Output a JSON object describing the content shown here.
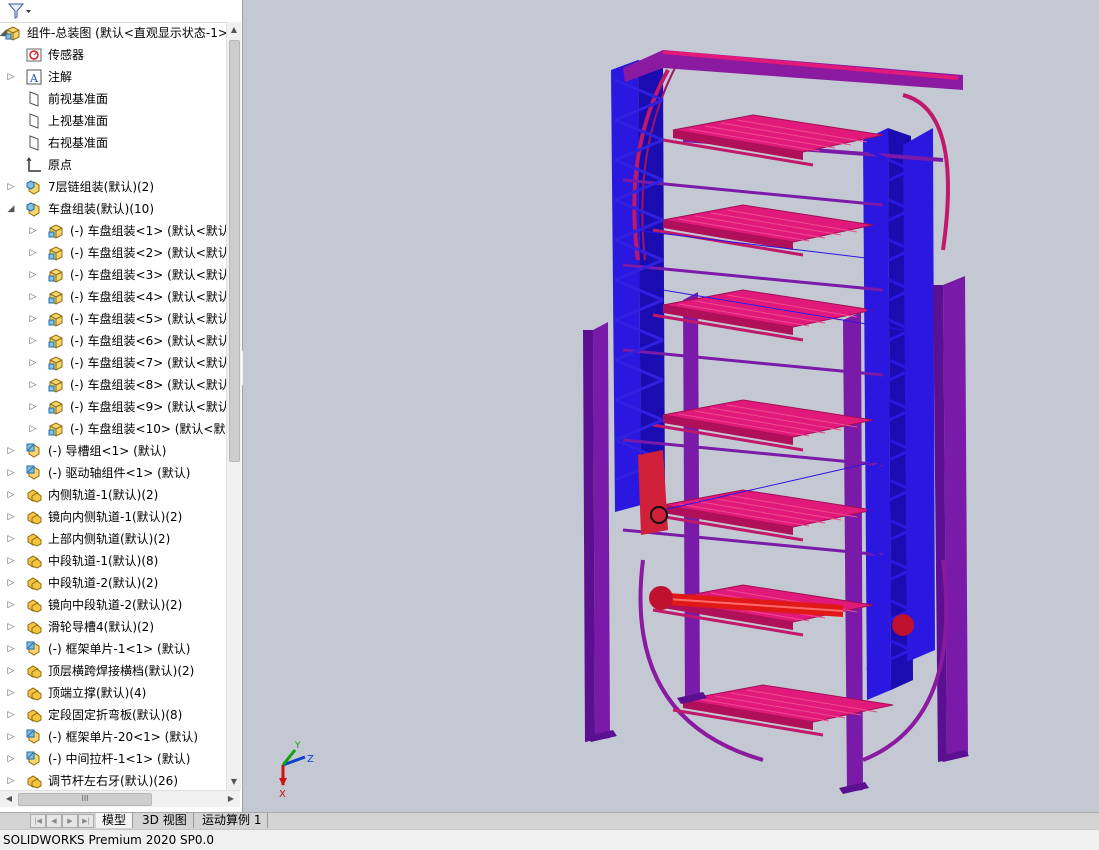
{
  "app": {
    "status_text": "SOLIDWORKS Premium 2020 SP0.0"
  },
  "tree": [
    {
      "label": "组件-总装图 (默认<直观显示状态-1>",
      "icon": "assembly-icon",
      "level": 0,
      "expander": "down"
    },
    {
      "label": "传感器",
      "icon": "sensor-icon",
      "level": 1,
      "expander": ""
    },
    {
      "label": "注解",
      "icon": "annotation-icon",
      "level": 1,
      "expander": "right"
    },
    {
      "label": "前视基准面",
      "icon": "plane-icon",
      "level": 1,
      "expander": ""
    },
    {
      "label": "上视基准面",
      "icon": "plane-icon",
      "level": 1,
      "expander": ""
    },
    {
      "label": "右视基准面",
      "icon": "plane-icon",
      "level": 1,
      "expander": ""
    },
    {
      "label": "原点",
      "icon": "origin-icon",
      "level": 1,
      "expander": ""
    },
    {
      "label": "7层链组装(默认)(2)",
      "icon": "subassembly-folder-icon",
      "level": 1,
      "expander": "right"
    },
    {
      "label": "车盘组装(默认)(10)",
      "icon": "subassembly-folder-icon",
      "level": 1,
      "expander": "down"
    },
    {
      "label": "(-) 车盘组装<1> (默认<默认",
      "icon": "assembly-icon",
      "level": 2,
      "expander": "right"
    },
    {
      "label": "(-) 车盘组装<2> (默认<默认",
      "icon": "assembly-icon",
      "level": 2,
      "expander": "right"
    },
    {
      "label": "(-) 车盘组装<3> (默认<默认",
      "icon": "assembly-icon",
      "level": 2,
      "expander": "right"
    },
    {
      "label": "(-) 车盘组装<4> (默认<默认",
      "icon": "assembly-icon",
      "level": 2,
      "expander": "right"
    },
    {
      "label": "(-) 车盘组装<5> (默认<默认",
      "icon": "assembly-icon",
      "level": 2,
      "expander": "right"
    },
    {
      "label": "(-) 车盘组装<6> (默认<默认",
      "icon": "assembly-icon",
      "level": 2,
      "expander": "right"
    },
    {
      "label": "(-) 车盘组装<7> (默认<默认",
      "icon": "assembly-icon",
      "level": 2,
      "expander": "right"
    },
    {
      "label": "(-) 车盘组装<8> (默认<默认",
      "icon": "assembly-icon",
      "level": 2,
      "expander": "right"
    },
    {
      "label": "(-) 车盘组装<9> (默认<默认",
      "icon": "assembly-icon",
      "level": 2,
      "expander": "right"
    },
    {
      "label": "(-) 车盘组装<10> (默认<默",
      "icon": "assembly-icon",
      "level": 2,
      "expander": "right"
    },
    {
      "label": "(-) 导槽组<1> (默认)",
      "icon": "part-icon",
      "level": 1,
      "expander": "right"
    },
    {
      "label": "(-) 驱动轴组件<1> (默认)",
      "icon": "part-icon",
      "level": 1,
      "expander": "right"
    },
    {
      "label": "内侧轨道-1(默认)(2)",
      "icon": "part-folder-icon",
      "level": 1,
      "expander": "right"
    },
    {
      "label": "镜向内侧轨道-1(默认)(2)",
      "icon": "part-folder-icon",
      "level": 1,
      "expander": "right"
    },
    {
      "label": "上部内侧轨道(默认)(2)",
      "icon": "part-folder-icon",
      "level": 1,
      "expander": "right"
    },
    {
      "label": "中段轨道-1(默认)(8)",
      "icon": "part-folder-icon",
      "level": 1,
      "expander": "right"
    },
    {
      "label": "中段轨道-2(默认)(2)",
      "icon": "part-folder-icon",
      "level": 1,
      "expander": "right"
    },
    {
      "label": "镜向中段轨道-2(默认)(2)",
      "icon": "part-folder-icon",
      "level": 1,
      "expander": "right"
    },
    {
      "label": "滑轮导槽4(默认)(2)",
      "icon": "part-folder-icon",
      "level": 1,
      "expander": "right"
    },
    {
      "label": "(-) 框架单片-1<1> (默认)",
      "icon": "part-icon",
      "level": 1,
      "expander": "right"
    },
    {
      "label": "顶层横跨焊接横档(默认)(2)",
      "icon": "part-folder-icon",
      "level": 1,
      "expander": "right"
    },
    {
      "label": "顶端立撑(默认)(4)",
      "icon": "part-folder-icon",
      "level": 1,
      "expander": "right"
    },
    {
      "label": "定段固定折弯板(默认)(8)",
      "icon": "part-folder-icon",
      "level": 1,
      "expander": "right"
    },
    {
      "label": "(-) 框架单片-20<1> (默认)",
      "icon": "part-icon",
      "level": 1,
      "expander": "right"
    },
    {
      "label": "(-) 中间拉杆-1<1> (默认)",
      "icon": "part-icon",
      "level": 1,
      "expander": "right"
    },
    {
      "label": "调节杆左右牙(默认)(26)",
      "icon": "part-folder-icon",
      "level": 1,
      "expander": "right"
    }
  ],
  "tabs": [
    {
      "label": "模型",
      "active": true
    },
    {
      "label": "3D 视图",
      "active": false
    },
    {
      "label": "运动算例 1",
      "active": false
    }
  ],
  "triad": {
    "y_label": "Y",
    "z_label": "Z",
    "x_label": "X"
  },
  "colors": {
    "frame_blue": "#2a17e0",
    "frame_purple": "#7a1aa8",
    "pallet_magenta": "#e0197a",
    "viewport_bg": "#c4c8d2"
  }
}
